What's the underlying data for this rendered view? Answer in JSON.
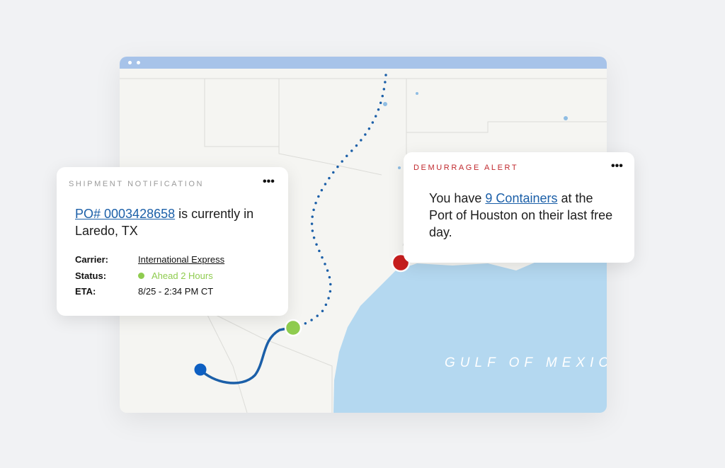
{
  "colors": {
    "accent": "#1b5fa8",
    "alert": "#c0282d",
    "status_ok": "#8fcc4f",
    "water": "#b4d8f0",
    "titlebar": "#a7c3e9"
  },
  "map": {
    "water_label": "GULF OF MEXICO"
  },
  "shipment": {
    "title": "SHIPMENT NOTIFICATION",
    "menu_icon": "more-horizontal-icon",
    "po_link": "PO# 0003428658",
    "headline_rest": " is currently in Laredo, TX",
    "carrier_label": "Carrier:",
    "carrier_value": "International Express",
    "status_label": "Status:",
    "status_value": "Ahead 2 Hours",
    "eta_label": "ETA:",
    "eta_value": "8/25 - 2:34 PM CT"
  },
  "alert": {
    "title": "DEMURRAGE ALERT",
    "menu_icon": "more-horizontal-icon",
    "text_before": "You have ",
    "containers_link": "9 Containers",
    "text_after": " at the Port of Houston on their last free day."
  }
}
